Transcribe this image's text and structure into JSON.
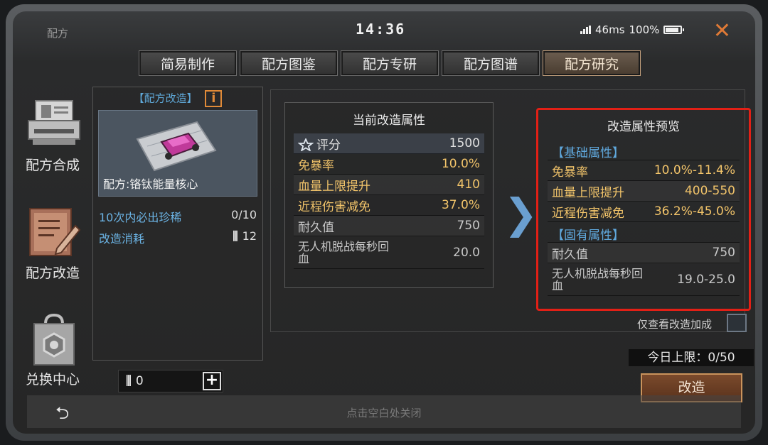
{
  "window": {
    "title": "配方",
    "clock": "14:36",
    "ping": "46ms",
    "battery": "100%"
  },
  "tabs": [
    {
      "label": "简易制作"
    },
    {
      "label": "配方图鉴"
    },
    {
      "label": "配方专研"
    },
    {
      "label": "配方图谱"
    },
    {
      "label": "配方研究",
      "active": true
    }
  ],
  "sidebar": {
    "items": [
      {
        "label": "配方合成",
        "icon": "printer-icon"
      },
      {
        "label": "配方改造",
        "icon": "clipboard-pencil-icon",
        "active": true
      },
      {
        "label": "兑换中心",
        "icon": "shopping-bag-icon"
      }
    ]
  },
  "recipe": {
    "header": "【配方改造】",
    "name": "配方:铬钛能量核心",
    "guarantee_label": "10次内必出珍稀",
    "guarantee_value": "0/10",
    "cost_label": "改造消耗",
    "cost_value": "12",
    "owned_value": "0"
  },
  "current": {
    "title": "当前改造属性",
    "score_label": "评分",
    "score_value": "1500",
    "rows": [
      {
        "label": "免暴率",
        "value": "10.0%"
      },
      {
        "label": "血量上限提升",
        "value": "410"
      },
      {
        "label": "近程伤害减免",
        "value": "37.0%"
      },
      {
        "label": "耐久值",
        "value": "750"
      },
      {
        "label": "无人机脱战每秒回血",
        "value": "20.0"
      }
    ]
  },
  "preview": {
    "title": "改造属性预览",
    "base_section": "【基础属性】",
    "fixed_section": "【固有属性】",
    "base_rows": [
      {
        "label": "免暴率",
        "value": "10.0%-11.4%"
      },
      {
        "label": "血量上限提升",
        "value": "400-550"
      },
      {
        "label": "近程伤害减免",
        "value": "36.2%-45.0%"
      }
    ],
    "fixed_rows": [
      {
        "label": "耐久值",
        "value": "750"
      },
      {
        "label": "无人机脱战每秒回血",
        "value": "19.0-25.0"
      }
    ]
  },
  "controls": {
    "only_modified_label": "仅查看改造加成",
    "daily_limit": "今日上限：0/50",
    "modify_button": "改造",
    "close_hint": "点击空白处关闭"
  },
  "colors": {
    "accent_orange": "#e07a36",
    "attr_gold": "#f2c46a",
    "label_blue": "#60a9de",
    "highlight_red": "#e22016"
  }
}
